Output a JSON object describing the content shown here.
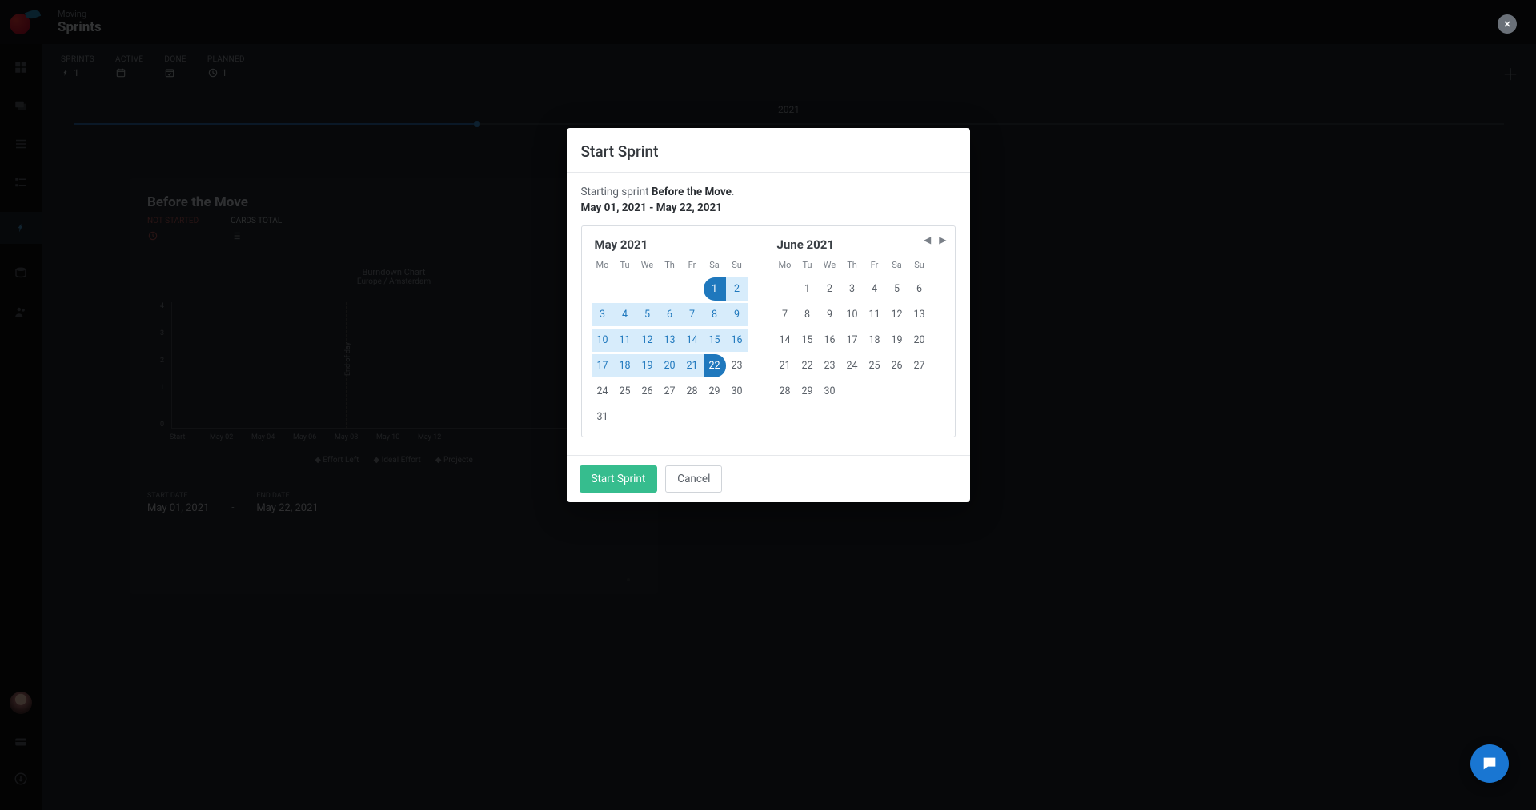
{
  "breadcrumb": {
    "project": "Moving",
    "page": "Sprints"
  },
  "stats": {
    "sprints": {
      "label": "SPRINTS",
      "value": "1"
    },
    "active": {
      "label": "ACTIVE"
    },
    "done": {
      "label": "DONE"
    },
    "planned": {
      "label": "PLANNED",
      "value": "1"
    }
  },
  "timeline_year": "2021",
  "sprint_card": {
    "title": "Before the Move",
    "mini": {
      "notstarted": "NOT STARTED",
      "cardstotal": "CARDS TOTAL"
    },
    "chart_data": {
      "type": "line",
      "title": "Burndown Chart",
      "subtitle": "Europe / Amsterdam",
      "ylabel": "",
      "ylim": [
        0,
        4
      ],
      "yticks": [
        0,
        1,
        2,
        3,
        4
      ],
      "x": [
        "Start",
        "May 02",
        "May 04",
        "May 06",
        "May 08",
        "May 10",
        "May 12"
      ],
      "series": [
        {
          "name": "Effort Left",
          "values": []
        },
        {
          "name": "Ideal Effort",
          "values": []
        },
        {
          "name": "Projected",
          "values": []
        }
      ],
      "annotation": {
        "x": "May 08",
        "label": "End of day"
      }
    },
    "legend": {
      "effort": "Effort Left",
      "ideal": "Ideal Effort",
      "proj": "Projecte"
    },
    "dates": {
      "start_label": "START DATE",
      "start": "May 01, 2021",
      "end_label": "END DATE",
      "end": "May 22, 2021",
      "sep": "-"
    }
  },
  "modal": {
    "title": "Start Sprint",
    "lead_prefix": "Starting sprint ",
    "lead_name": "Before the Move",
    "lead_suffix": ".",
    "range": "May 01, 2021 - May 22, 2021",
    "month_left": "May 2021",
    "month_right": "June 2021",
    "dow": [
      "Mo",
      "Tu",
      "We",
      "Th",
      "Fr",
      "Sa",
      "Su"
    ],
    "may": {
      "lead_blank": 5,
      "days": 31,
      "range_start": 1,
      "range_end": 22
    },
    "june": {
      "lead_blank": 1,
      "days": 30
    },
    "buttons": {
      "primary": "Start Sprint",
      "secondary": "Cancel"
    }
  }
}
